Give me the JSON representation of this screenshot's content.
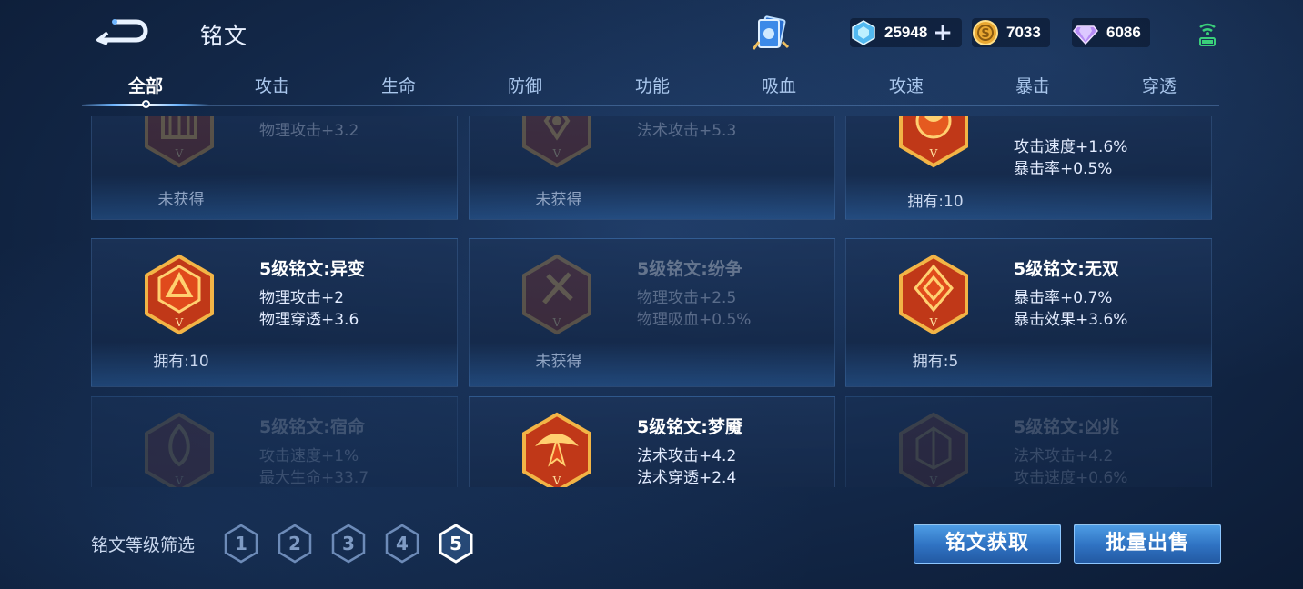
{
  "header": {
    "title": "铭文",
    "currencies": [
      {
        "name": "gem-icon",
        "value": "25948",
        "color": "#7fe0ff"
      },
      {
        "name": "gold-coin-icon",
        "value": "7033",
        "color": "#f0b540"
      },
      {
        "name": "diamond-icon",
        "value": "6086",
        "color": "#c79cff"
      }
    ]
  },
  "tabs": [
    {
      "label": "全部",
      "active": true
    },
    {
      "label": "攻击"
    },
    {
      "label": "生命"
    },
    {
      "label": "防御"
    },
    {
      "label": "功能"
    },
    {
      "label": "吸血"
    },
    {
      "label": "攻速"
    },
    {
      "label": "暴击"
    },
    {
      "label": "穿透"
    }
  ],
  "cards": [
    {
      "title": "",
      "stats": [
        "物理攻击+3.2",
        ""
      ],
      "owned": "未获得",
      "obtained": false
    },
    {
      "title": "",
      "stats": [
        "法术攻击+5.3",
        ""
      ],
      "owned": "未获得",
      "obtained": false
    },
    {
      "title": "",
      "stats": [
        "攻击速度+1.6%",
        "暴击率+0.5%"
      ],
      "owned": "拥有:10",
      "obtained": true
    },
    {
      "title": "5级铭文:异变",
      "stats": [
        "物理攻击+2",
        "物理穿透+3.6"
      ],
      "owned": "拥有:10",
      "obtained": true
    },
    {
      "title": "5级铭文:纷争",
      "stats": [
        "物理攻击+2.5",
        "物理吸血+0.5%"
      ],
      "owned": "未获得",
      "obtained": false
    },
    {
      "title": "5级铭文:无双",
      "stats": [
        "暴击率+0.7%",
        "暴击效果+3.6%"
      ],
      "owned": "拥有:5",
      "obtained": true
    },
    {
      "title": "5级铭文:宿命",
      "stats": [
        "攻击速度+1%",
        "最大生命+33.7"
      ],
      "owned": "",
      "obtained": false
    },
    {
      "title": "5级铭文:梦魇",
      "stats": [
        "法术攻击+4.2",
        "法术穿透+2.4"
      ],
      "owned": "",
      "obtained": true
    },
    {
      "title": "5级铭文:凶兆",
      "stats": [
        "法术攻击+4.2",
        "攻击速度+0.6%"
      ],
      "owned": "",
      "obtained": false
    }
  ],
  "footer": {
    "filter_label": "铭文等级筛选",
    "levels": [
      "1",
      "2",
      "3",
      "4",
      "5"
    ],
    "active_level": "5",
    "obtain_button": "铭文获取",
    "sell_button": "批量出售"
  }
}
